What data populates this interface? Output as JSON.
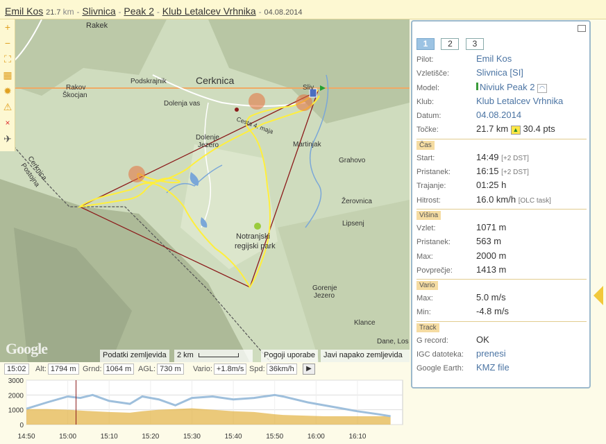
{
  "header": {
    "pilot": "Emil Kos",
    "distance": "21.7",
    "distance_unit": "km",
    "launch": "Slivnica",
    "glider": "Peak 2",
    "club": "Klub Letalcev Vrhnika",
    "date": "04.08.2014",
    "sep": "-"
  },
  "map": {
    "places": {
      "rakek": "Rakek",
      "podskrajnik": "Podskrajnik",
      "cerknica": "Cerknica",
      "dolenja_vas": "Dolenja vas",
      "rakov_skocjan": "Rakov\nŠkocjan",
      "dolenje_jezero": "Dolenje\nJezero",
      "martinjak": "Martinjak",
      "grahovo": "Grahovo",
      "zerovnica": "Žerovnica",
      "lipsenj": "Lipsenj",
      "park": "Notranjski\nregijski park",
      "gorenje_jezero": "Gorenje\nJezero",
      "klance": "Klance",
      "dane": "Dane, Los",
      "cerknica_postojna": "Cerknica\nPostojna",
      "sliv": "Sliv",
      "cesta": "Cesta 4. maja"
    },
    "footer": {
      "map_data": "Podatki zemljevida",
      "scale": "2 km",
      "terms": "Pogoji uporabe",
      "report": "Javi napako zemljevida"
    },
    "logo": "Google"
  },
  "toolbar": {
    "zoom_in": "+",
    "zoom_out": "−",
    "close": "×",
    "plane": "✈"
  },
  "statbar": {
    "time": "15:02",
    "alt_label": "Alt:",
    "alt": "1794 m",
    "grnd_label": "Grnd:",
    "grnd": "1064 m",
    "agl_label": "AGL:",
    "agl": "730 m",
    "vario_label": "Vario:",
    "vario": "+1.8m/s",
    "spd_label": "Spd:",
    "spd": "36km/h",
    "play": "▶"
  },
  "chart_data": {
    "type": "line",
    "x_ticks": [
      "14:50",
      "15:00",
      "15:10",
      "15:20",
      "15:30",
      "15:40",
      "15:50",
      "16:00",
      "16:10"
    ],
    "y_ticks": [
      "0",
      "1000",
      "2000",
      "3000"
    ],
    "ylim": [
      0,
      3000
    ],
    "cursor_time": "15:02",
    "x_minutes": [
      0,
      5,
      10,
      13,
      16,
      20,
      25,
      28,
      32,
      36,
      40,
      45,
      50,
      55,
      60,
      62,
      68,
      72,
      76,
      80,
      85,
      88
    ],
    "series": [
      {
        "values": [
          1071,
          1500,
          1900,
          1800,
          2000,
          1600,
          1400,
          1900,
          1700,
          1300,
          1800,
          1900,
          1700,
          1800,
          2000,
          1900,
          1500,
          1300,
          1100,
          900,
          700,
          563
        ]
      },
      {
        "values": [
          1050,
          1050,
          1000,
          950,
          900,
          850,
          800,
          900,
          1000,
          1050,
          1100,
          1000,
          900,
          850,
          700,
          650,
          600,
          560,
          560,
          560,
          560,
          560
        ]
      }
    ],
    "colors": {
      "altitude": "#9ebfdc",
      "ground": "#e3b242",
      "cursor": "#8b1a1a"
    }
  },
  "panel": {
    "tabs": [
      "1",
      "2",
      "3"
    ],
    "rows": {
      "pilot_label": "Pilot:",
      "pilot": "Emil Kos",
      "launch_label": "Vzletišče:",
      "launch": "Slivnica [SI]",
      "model_label": "Model:",
      "model": "Niviuk Peak 2",
      "club_label": "Klub:",
      "club": "Klub Letalcev Vrhnika",
      "date_label": "Datum:",
      "date": "04.08.2014",
      "points_label": "Točke:",
      "points_km": "21.7 km",
      "points": "30.4 pts"
    },
    "time": {
      "section": "Čas",
      "start_label": "Start:",
      "start": "14:49",
      "start_note": "[+2 DST]",
      "landing_label": "Pristanek:",
      "landing": "16:15",
      "landing_note": "[+2 DST]",
      "duration_label": "Trajanje:",
      "duration": "01:25 h",
      "speed_label": "Hitrost:",
      "speed": "16.0 km/h",
      "speed_note": "[OLC task]"
    },
    "height": {
      "section": "Višina",
      "launch_label": "Vzlet:",
      "launch": "1071 m",
      "landing_label": "Pristanek:",
      "landing": "563 m",
      "max_label": "Max:",
      "max": "2000 m",
      "avg_label": "Povprečje:",
      "avg": "1413 m"
    },
    "vario": {
      "section": "Vario",
      "max_label": "Max:",
      "max": "5.0 m/s",
      "min_label": "Min:",
      "min": "-4.8 m/s"
    },
    "track": {
      "section": "Track",
      "grecord_label": "G record:",
      "grecord": "OK",
      "igc_label": "IGC datoteka:",
      "igc": "prenesi",
      "ge_label": "Google Earth:",
      "ge": "KMZ file"
    }
  },
  "icons": {
    "restore": "restore-window-icon",
    "glider": "glider-icon",
    "points": "triangle-icon"
  }
}
